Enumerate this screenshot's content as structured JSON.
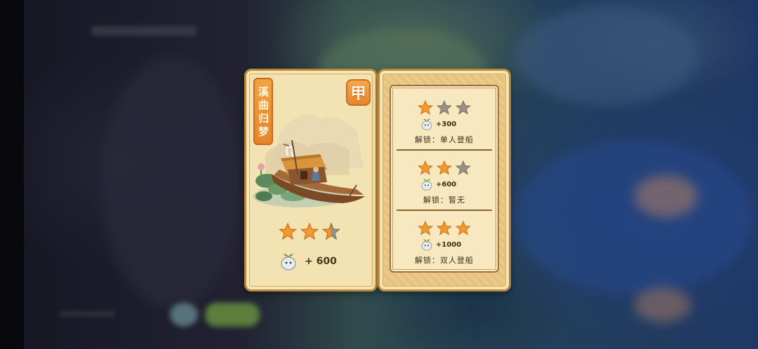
{
  "card": {
    "title": "溪曲归梦",
    "grade": "甲",
    "stars": 3,
    "filled_stars": 2.5,
    "reward_icon": "sprout-spirit-icon",
    "reward_text": "+ 600"
  },
  "tiers": [
    {
      "stars_filled": 1,
      "stars_total": 3,
      "reward": "+300",
      "unlock": "解锁：单人登船"
    },
    {
      "stars_filled": 2,
      "stars_total": 3,
      "reward": "+600",
      "unlock": "解锁：暂无"
    },
    {
      "stars_filled": 3,
      "stars_total": 3,
      "reward": "+1000",
      "unlock": "解锁：双人登船"
    }
  ],
  "colors": {
    "star_filled": "#f29a2e",
    "star_empty": "#9a9184",
    "card_border": "#b98a3e",
    "tab_orange": "#e98d2f"
  }
}
